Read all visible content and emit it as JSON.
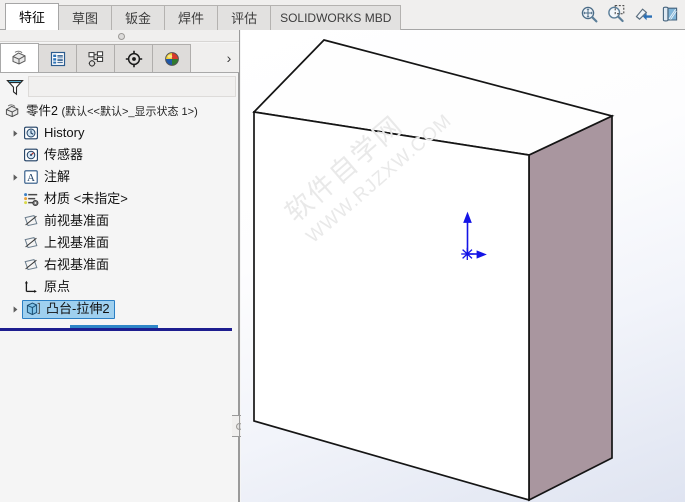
{
  "ribbon": {
    "tabs": [
      {
        "label": "特征",
        "active": true
      },
      {
        "label": "草图",
        "active": false
      },
      {
        "label": "钣金",
        "active": false
      },
      {
        "label": "焊件",
        "active": false
      },
      {
        "label": "评估",
        "active": false
      },
      {
        "label": "SOLIDWORKS MBD",
        "active": false
      }
    ],
    "view_tools": [
      {
        "name": "zoom-to-fit-icon"
      },
      {
        "name": "zoom-to-area-icon"
      },
      {
        "name": "zoom-in-out-icon"
      },
      {
        "name": "section-view-icon"
      }
    ]
  },
  "feature_manager": {
    "tabs": [
      {
        "name": "feature-tree-tab",
        "active": true
      },
      {
        "name": "property-manager-tab",
        "active": false
      },
      {
        "name": "configuration-manager-tab",
        "active": false
      },
      {
        "name": "dimxpert-manager-tab",
        "active": false
      },
      {
        "name": "display-manager-tab",
        "active": false
      }
    ],
    "more_tabs_label": "›",
    "filter": {
      "icon": "filter-icon",
      "value": "",
      "placeholder": ""
    },
    "tree": [
      {
        "label": "零件2",
        "suffix": "(默认<<默认>_显示状态 1>)",
        "icon": "part-icon",
        "indent": 0,
        "arrow": "none",
        "selected": false
      },
      {
        "label": "History",
        "suffix": "",
        "icon": "history-icon",
        "indent": 1,
        "arrow": "collapsed",
        "selected": false
      },
      {
        "label": "传感器",
        "suffix": "",
        "icon": "sensor-icon",
        "indent": 1,
        "arrow": "none",
        "selected": false
      },
      {
        "label": "注解",
        "suffix": "",
        "icon": "annotations-icon",
        "indent": 1,
        "arrow": "collapsed",
        "selected": false
      },
      {
        "label": "材质",
        "suffix": "<未指定>",
        "icon": "material-icon",
        "indent": 1,
        "arrow": "none",
        "selected": false
      },
      {
        "label": "前视基准面",
        "suffix": "",
        "icon": "plane-icon",
        "indent": 1,
        "arrow": "none",
        "selected": false
      },
      {
        "label": "上视基准面",
        "suffix": "",
        "icon": "plane-icon",
        "indent": 1,
        "arrow": "none",
        "selected": false
      },
      {
        "label": "右视基准面",
        "suffix": "",
        "icon": "plane-icon",
        "indent": 1,
        "arrow": "none",
        "selected": false
      },
      {
        "label": "原点",
        "suffix": "",
        "icon": "origin-icon",
        "indent": 1,
        "arrow": "none",
        "selected": false
      },
      {
        "label": "凸台-拉伸2",
        "suffix": "",
        "icon": "boss-extrude-icon",
        "indent": 1,
        "arrow": "collapsed",
        "selected": true
      }
    ],
    "rollback_bar": true
  },
  "graphics": {
    "watermark_line1": "软件自学网",
    "watermark_line2": "WWW.RJZXW.COM",
    "model": {
      "name": "extruded-box",
      "edge_color": "#151515",
      "front_face_color": "#ffffff",
      "top_face_color": "#ffffff",
      "right_face_color": "#a9969f"
    },
    "origin_triad": {
      "name": "origin-triad",
      "color": "#1414e6"
    },
    "background_top": "#ffffff",
    "background_bottom": "#dfe4f1"
  }
}
